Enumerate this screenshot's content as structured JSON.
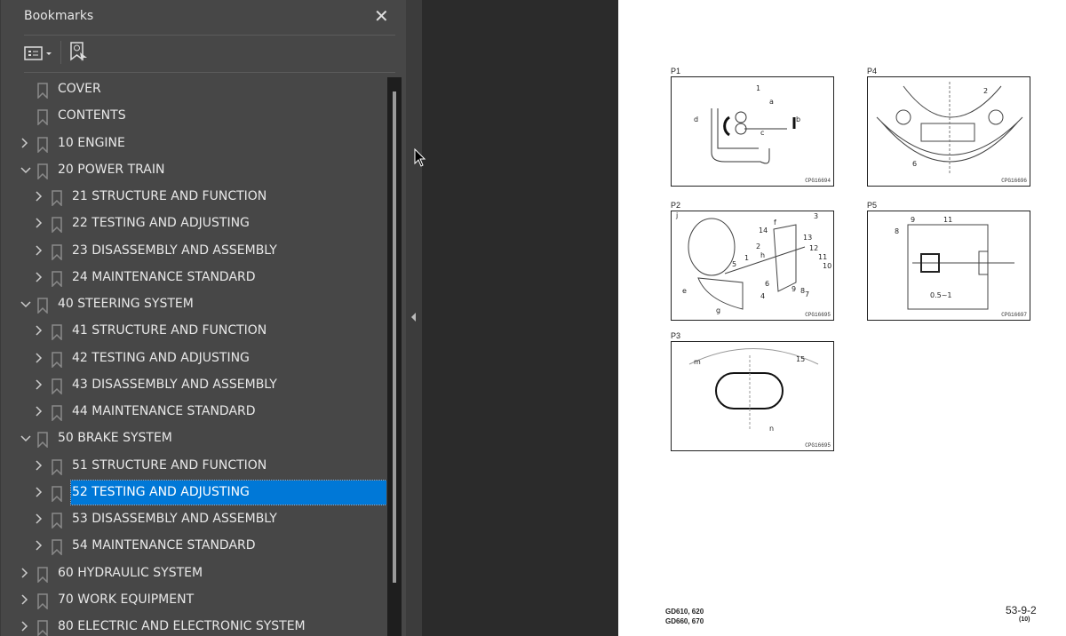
{
  "panel": {
    "title": "Bookmarks",
    "close_icon": "close-icon",
    "options_icon": "list-options-icon",
    "find_icon": "find-bookmark-icon"
  },
  "bookmarks": [
    {
      "label": "COVER",
      "level": 0,
      "expander": "none"
    },
    {
      "label": "CONTENTS",
      "level": 0,
      "expander": "none"
    },
    {
      "label": "10 ENGINE",
      "level": 0,
      "expander": "collapsed"
    },
    {
      "label": "20 POWER TRAIN",
      "level": 0,
      "expander": "expanded"
    },
    {
      "label": "21 STRUCTURE AND FUNCTION",
      "level": 1,
      "expander": "collapsed"
    },
    {
      "label": "22 TESTING AND ADJUSTING",
      "level": 1,
      "expander": "collapsed"
    },
    {
      "label": "23 DISASSEMBLY AND ASSEMBLY",
      "level": 1,
      "expander": "collapsed"
    },
    {
      "label": "24 MAINTENANCE STANDARD",
      "level": 1,
      "expander": "collapsed"
    },
    {
      "label": "40 STEERING SYSTEM",
      "level": 0,
      "expander": "expanded"
    },
    {
      "label": "41 STRUCTURE AND FUNCTION",
      "level": 1,
      "expander": "collapsed"
    },
    {
      "label": "42 TESTING AND ADJUSTING",
      "level": 1,
      "expander": "collapsed"
    },
    {
      "label": "43 DISASSEMBLY AND ASSEMBLY",
      "level": 1,
      "expander": "collapsed"
    },
    {
      "label": "44 MAINTENANCE STANDARD",
      "level": 1,
      "expander": "collapsed"
    },
    {
      "label": "50 BRAKE SYSTEM",
      "level": 0,
      "expander": "expanded"
    },
    {
      "label": "51 STRUCTURE AND FUNCTION",
      "level": 1,
      "expander": "collapsed"
    },
    {
      "label": "52 TESTING AND ADJUSTING",
      "level": 1,
      "expander": "collapsed",
      "selected": true
    },
    {
      "label": "53 DISASSEMBLY AND ASSEMBLY",
      "level": 1,
      "expander": "collapsed"
    },
    {
      "label": "54 MAINTENANCE STANDARD",
      "level": 1,
      "expander": "collapsed"
    },
    {
      "label": "60 HYDRAULIC SYSTEM",
      "level": 0,
      "expander": "collapsed"
    },
    {
      "label": "70 WORK EQUIPMENT",
      "level": 0,
      "expander": "collapsed"
    },
    {
      "label": "80 ELECTRIC AND ELECTRONIC SYSTEM",
      "level": 0,
      "expander": "collapsed"
    }
  ],
  "colors": {
    "selection": "#0078d7",
    "panel": "#474747",
    "page": "#ffffff"
  },
  "page": {
    "figures": [
      {
        "id": "P1",
        "code": "CPG16694",
        "callouts": [
          "1",
          "a",
          "b",
          "c",
          "d"
        ]
      },
      {
        "id": "P4",
        "code": "CPG16696",
        "callouts": [
          "2",
          "6"
        ]
      },
      {
        "id": "P2",
        "code": "CPG16695",
        "callouts": [
          "j",
          "f",
          "3",
          "14",
          "13",
          "2",
          "12",
          "11",
          "10",
          "1",
          "h",
          "5",
          "6",
          "9",
          "8",
          "7",
          "4",
          "e",
          "g"
        ]
      },
      {
        "id": "P5",
        "code": "CPG16697",
        "callouts": [
          "8",
          "9",
          "11",
          "0.5~1"
        ]
      },
      {
        "id": "P3",
        "code": "CPG16695",
        "callouts": [
          "m",
          "15",
          "n"
        ]
      }
    ],
    "footer": {
      "models": [
        "GD610, 620",
        "GD660, 670"
      ],
      "page_number": "53-9-2",
      "revision": "(10)"
    }
  }
}
